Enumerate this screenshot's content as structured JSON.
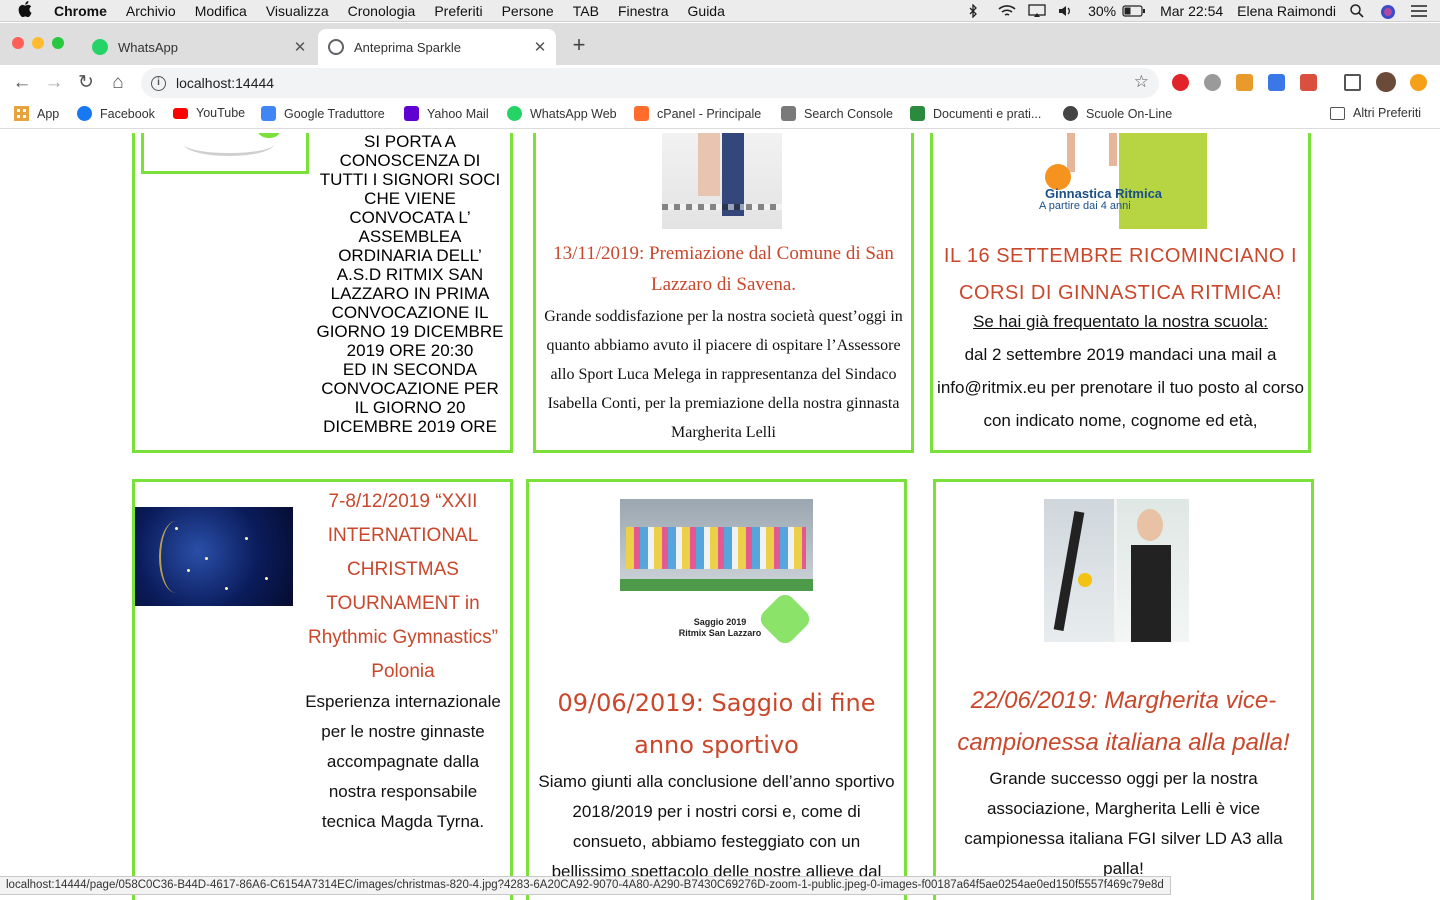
{
  "menubar": {
    "app": "Chrome",
    "items": [
      "Archivio",
      "Modifica",
      "Visualizza",
      "Cronologia",
      "Preferiti",
      "Persone",
      "TAB",
      "Finestra",
      "Guida"
    ],
    "battery": "30%",
    "clock": "Mar 22:54",
    "user": "Elena Raimondi"
  },
  "tabs": [
    {
      "title": "WhatsApp",
      "icon": "whatsapp-icon",
      "color": "#25d366"
    },
    {
      "title": "Anteprima Sparkle",
      "icon": "globe-icon",
      "color": "#5f6368"
    }
  ],
  "toolbar": {
    "url": "localhost:14444"
  },
  "bookmarks": [
    {
      "label": "App",
      "icon": "apps-grid-icon",
      "color": "#e8a33c"
    },
    {
      "label": "Facebook",
      "icon": "facebook-icon",
      "color": "#1877f2"
    },
    {
      "label": "YouTube",
      "icon": "youtube-icon",
      "color": "#ff0000"
    },
    {
      "label": "Google Traduttore",
      "icon": "google-translate-icon",
      "color": "#4285f4"
    },
    {
      "label": "Yahoo Mail",
      "icon": "yahoo-icon",
      "color": "#5f01d1"
    },
    {
      "label": "WhatsApp Web",
      "icon": "whatsapp-icon",
      "color": "#25d366"
    },
    {
      "label": "cPanel - Principale",
      "icon": "cpanel-icon",
      "color": "#ff6c2c"
    },
    {
      "label": "Search Console",
      "icon": "search-console-icon",
      "color": "#7a7a7a"
    },
    {
      "label": "Documenti e prati...",
      "icon": "document-icon",
      "color": "#2c8a3f"
    },
    {
      "label": "Scuole On-Line",
      "icon": "globe-icon",
      "color": "#444444"
    }
  ],
  "other_bookmarks": "Altri Preferiti",
  "cards": {
    "c1": {
      "text": "SI PORTA A CONOSCENZA DI TUTTI I SIGNORI SOCI CHE VIENE CONVOCATA L’ ASSEMBLEA ORDINARIA DELL’ A.S.D RITMIX SAN LAZZARO IN PRIMA CONVOCAZIONE IL GIORNO 19 DICEMBRE 2019 ORE 20:30\nED IN SECONDA CONVOCAZIONE PER IL GIORNO 20 DICEMBRE 2019 ORE"
    },
    "c2": {
      "title": "13/11/2019: Premiazione dal Comune di San Lazzaro di Savena.",
      "body": "Grande soddisfazione per la nostra società quest’oggi in quanto abbiamo avuto il piacere di ospitare l’Assessore allo Sport Luca Melega in rappresentanza del Sindaco Isabella Conti, per la premiazione della nostra ginnasta Margherita Lelli"
    },
    "c3": {
      "image_title": "Ginnastica Ritmica",
      "image_sub": "A partire dai 4 anni",
      "title": "IL 16 SETTEMBRE RICOMINCIANO I CORSI DI GINNASTICA RITMICA!",
      "subtitle": "Se hai già frequentato la nostra scuola:",
      "body": "dal 2 settembre 2019 mandaci una mail a info@ritmix.eu per prenotare il tuo posto al corso con indicato nome, cognome ed età,"
    },
    "c4": {
      "title": "7-8/12/2019 “XXII INTERNATIONAL CHRISTMAS TOURNAMENT in Rhythmic Gymnastics” Polonia",
      "body": "Esperienza internazionale per le nostre ginnaste accompagnate dalla nostra responsabile tecnica Magda Tyrna."
    },
    "c5": {
      "image_caption": "Saggio 2019\nRitmix San Lazzaro",
      "title": "09/06/2019: Saggio di fine anno sportivo",
      "body": "Siamo giunti alla conclusione dell’anno sportivo 2018/2019 per i nostri corsi e, come di consueto, abbiamo festeggiato con un bellissimo spettacolo delle nostre allieve dal"
    },
    "c6": {
      "title": "22/06/2019: Margherita vice-campionessa italiana alla palla!",
      "body": "Grande successo oggi per la nostra associazione, Margherita Lelli è vice campionessa italiana FGI silver LD A3 alla palla!"
    }
  },
  "status_url": "localhost:14444/page/058C0C36-B44D-4617-86A6-C6154A7314EC/images/christmas-820-4.jpg?4283-6A20CA92-9070-4A80-A290-B7430C69276D-zoom-1-public.jpeg-0-images-f00187a64f5ae0254ae0ed150f5557f469c79e8d",
  "colors": {
    "card_border": "#7be03a",
    "title_red": "#c9472b"
  }
}
